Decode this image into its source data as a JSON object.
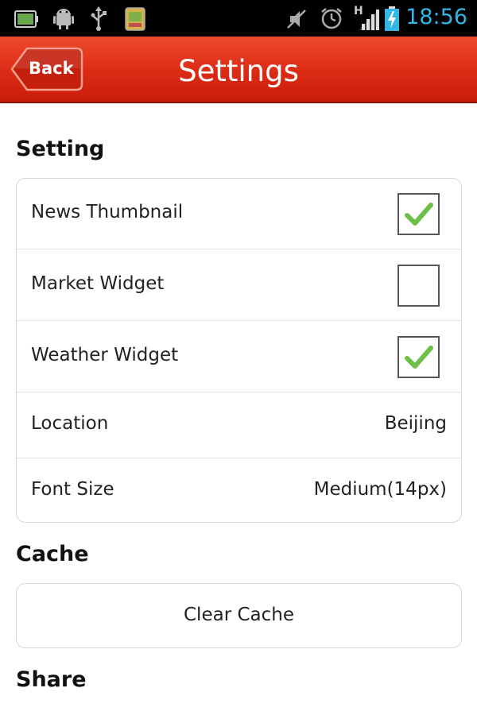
{
  "status_bar": {
    "time": "18:56",
    "icons": [
      "battery-status-icon",
      "android-debug-icon",
      "usb-icon",
      "sd-card-icon",
      "silent-mode-icon",
      "alarm-icon",
      "signal-hspa-icon",
      "battery-charging-icon"
    ],
    "network_label": "H",
    "time_color": "#33b5e5"
  },
  "header": {
    "back_label": "Back",
    "title": "Settings",
    "bar_color": "#dd2d16"
  },
  "setting_section": {
    "title": "Setting",
    "rows": [
      {
        "label": "News Thumbnail",
        "type": "checkbox",
        "checked": true
      },
      {
        "label": "Market Widget",
        "type": "checkbox",
        "checked": false
      },
      {
        "label": "Weather Widget",
        "type": "checkbox",
        "checked": true
      },
      {
        "label": "Location",
        "type": "value",
        "value": "Beijing"
      },
      {
        "label": "Font Size",
        "type": "value",
        "value": "Medium(14px)"
      }
    ]
  },
  "cache_section": {
    "title": "Cache",
    "button_label": "Clear Cache"
  },
  "share_section": {
    "title": "Share"
  },
  "colors": {
    "check_green": "#6cc04a"
  }
}
